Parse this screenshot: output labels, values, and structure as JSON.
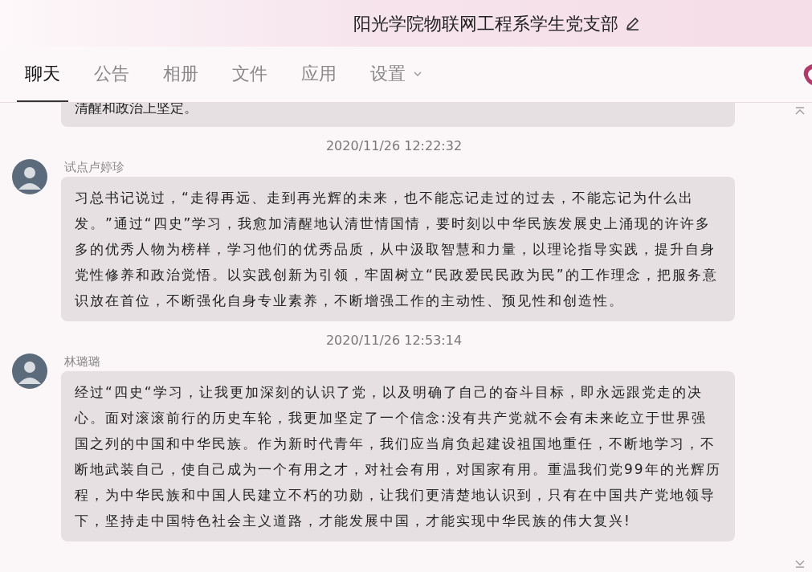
{
  "header": {
    "title": "阳光学院物联网工程系学生党支部"
  },
  "tabs": [
    {
      "label": "聊天",
      "selected": true,
      "dropdown": false
    },
    {
      "label": "公告",
      "selected": false,
      "dropdown": false
    },
    {
      "label": "相册",
      "selected": false,
      "dropdown": false
    },
    {
      "label": "文件",
      "selected": false,
      "dropdown": false
    },
    {
      "label": "应用",
      "selected": false,
      "dropdown": false
    },
    {
      "label": "设置",
      "selected": false,
      "dropdown": true
    }
  ],
  "messages": [
    {
      "kind": "partial",
      "text": "清醒和政治上坚定。"
    },
    {
      "kind": "message",
      "time": "2020/11/26 12:22:32",
      "sender": "试点卢婷珍",
      "text": "习总书记说过，“走得再远、走到再光辉的未来，也不能忘记走过的过去，不能忘记为什么出发。”通过“四史”学习，我愈加清醒地认清世情国情，要时刻以中华民族发展史上涌现的许许多多的优秀人物为榜样，学习他们的优秀品质，从中汲取智慧和力量，以理论指导实践，提升自身党性修养和政治觉悟。以实践创新为引领，牢固树立“民政爱民民政为民”的工作理念，把服务意识放在首位，不断强化自身专业素养，不断增强工作的主动性、预见性和创造性。"
    },
    {
      "kind": "message",
      "time": "2020/11/26 12:53:14",
      "sender": "林璐璐",
      "text": "经过“四史“学习，让我更加深刻的认识了党，以及明确了自己的奋斗目标，即永远跟党走的决心。面对滚滚前行的历史车轮，我更加坚定了一个信念:没有共产党就不会有未来屹立于世界强国之列的中国和中华民族。作为新时代青年，我们应当肩负起建设祖国地重任，不断地学习，不断地武装自己，使自己成为一个有用之才，对社会有用，对国家有用。重温我们党99年的光辉历程，为中华民族和中国人民建立不朽的功勋，让我们更清楚地认识到，只有在中国共产党地领导下，坚持走中国特色社会主义道路，才能发展中国，才能实现中华民族的伟大复兴!"
    }
  ]
}
